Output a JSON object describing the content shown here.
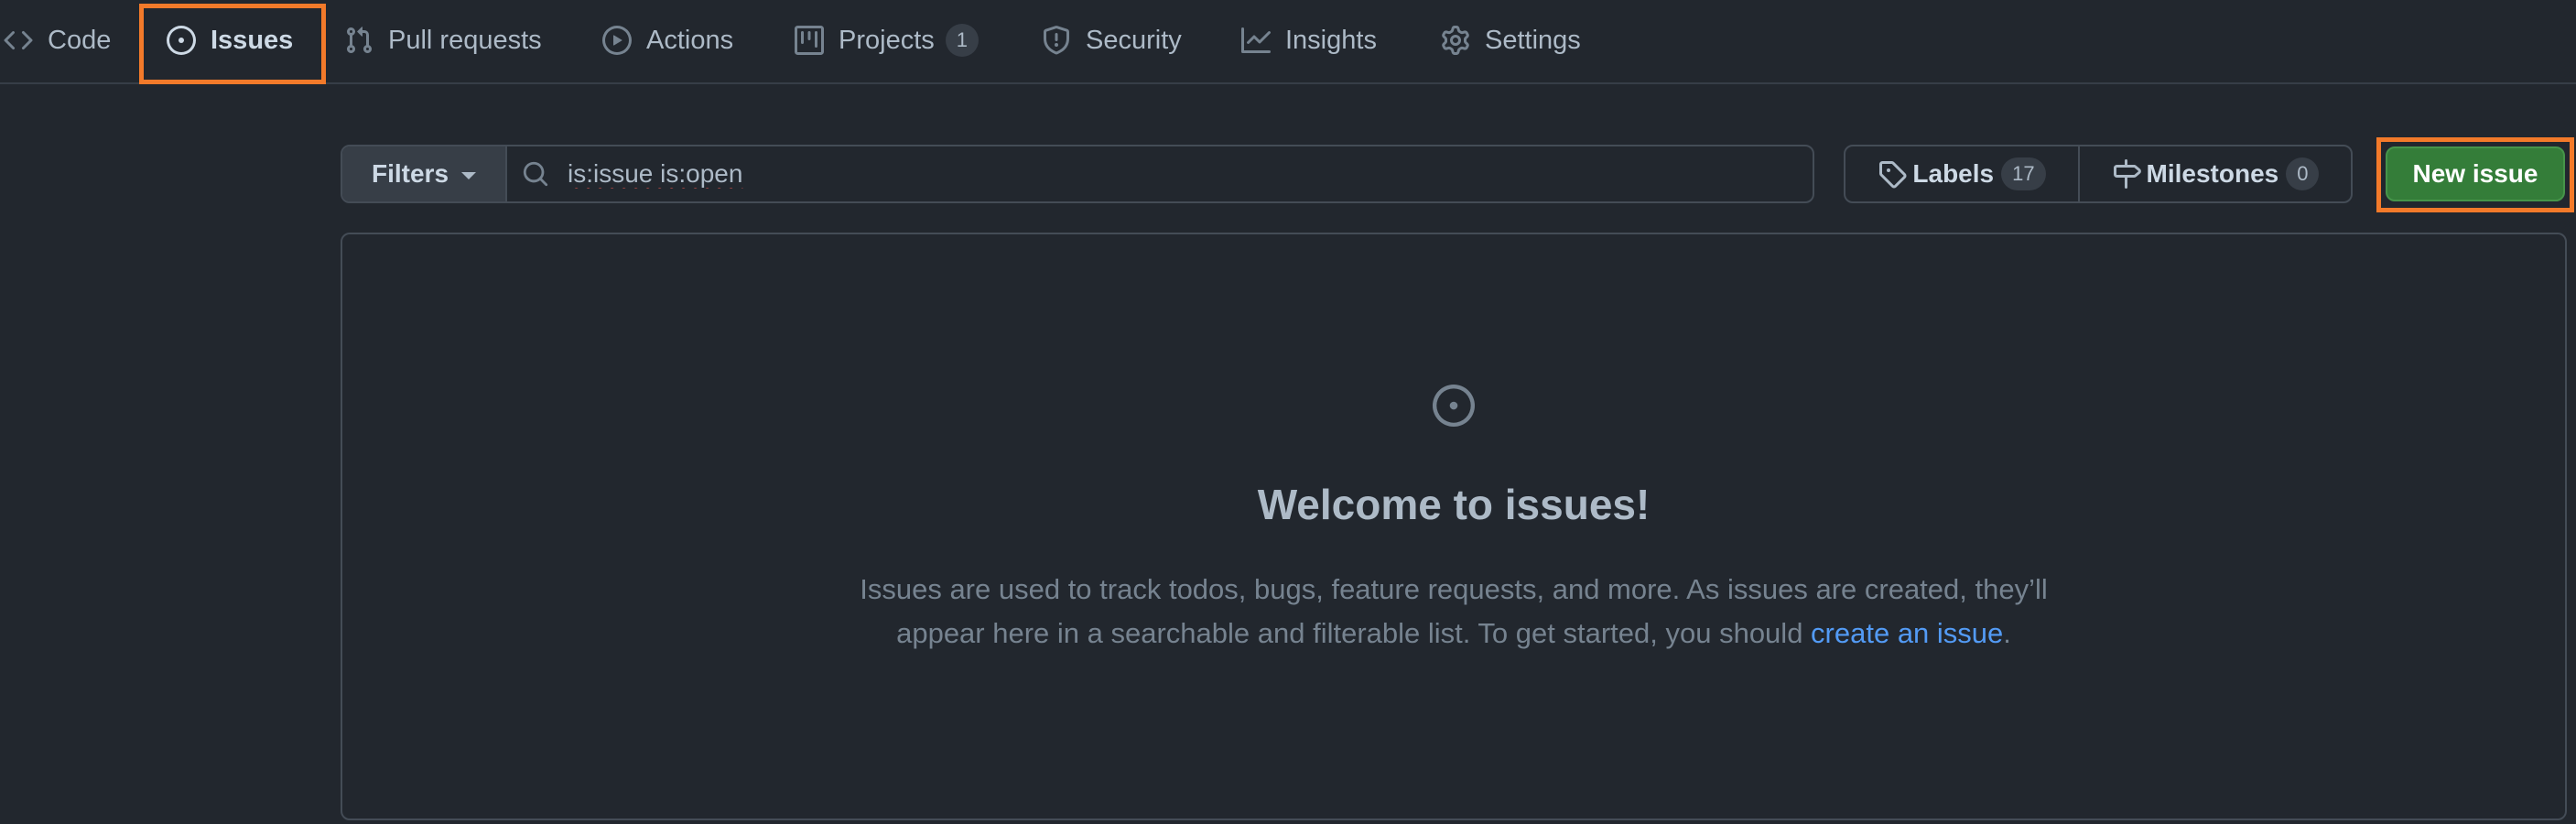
{
  "nav": {
    "tabs": [
      {
        "label": "Code",
        "icon": "code-icon"
      },
      {
        "label": "Issues",
        "icon": "issue-opened-icon",
        "active": true
      },
      {
        "label": "Pull requests",
        "icon": "git-pull-request-icon"
      },
      {
        "label": "Actions",
        "icon": "play-icon"
      },
      {
        "label": "Projects",
        "icon": "table-icon",
        "count": "1"
      },
      {
        "label": "Security",
        "icon": "shield-icon"
      },
      {
        "label": "Insights",
        "icon": "graph-icon"
      },
      {
        "label": "Settings",
        "icon": "gear-icon"
      }
    ]
  },
  "toolbar": {
    "filters_label": "Filters",
    "search_value": "is:issue is:open",
    "labels_label": "Labels",
    "labels_count": "17",
    "milestones_label": "Milestones",
    "milestones_count": "0",
    "new_issue_label": "New issue"
  },
  "blankslate": {
    "title": "Welcome to issues!",
    "line1": "Issues are used to track todos, bugs, feature requests, and more. As issues are created, they’ll",
    "line2_prefix": "appear here in a searchable and filterable list. To get started, you should ",
    "link_text": "create an issue",
    "line2_suffix": "."
  },
  "colors": {
    "background": "#22272e",
    "border": "#444c56",
    "primary_button": "#347d39",
    "link": "#539bf5",
    "highlight_box": "#f37a2a",
    "active_tab_underline": "#ec775c"
  }
}
